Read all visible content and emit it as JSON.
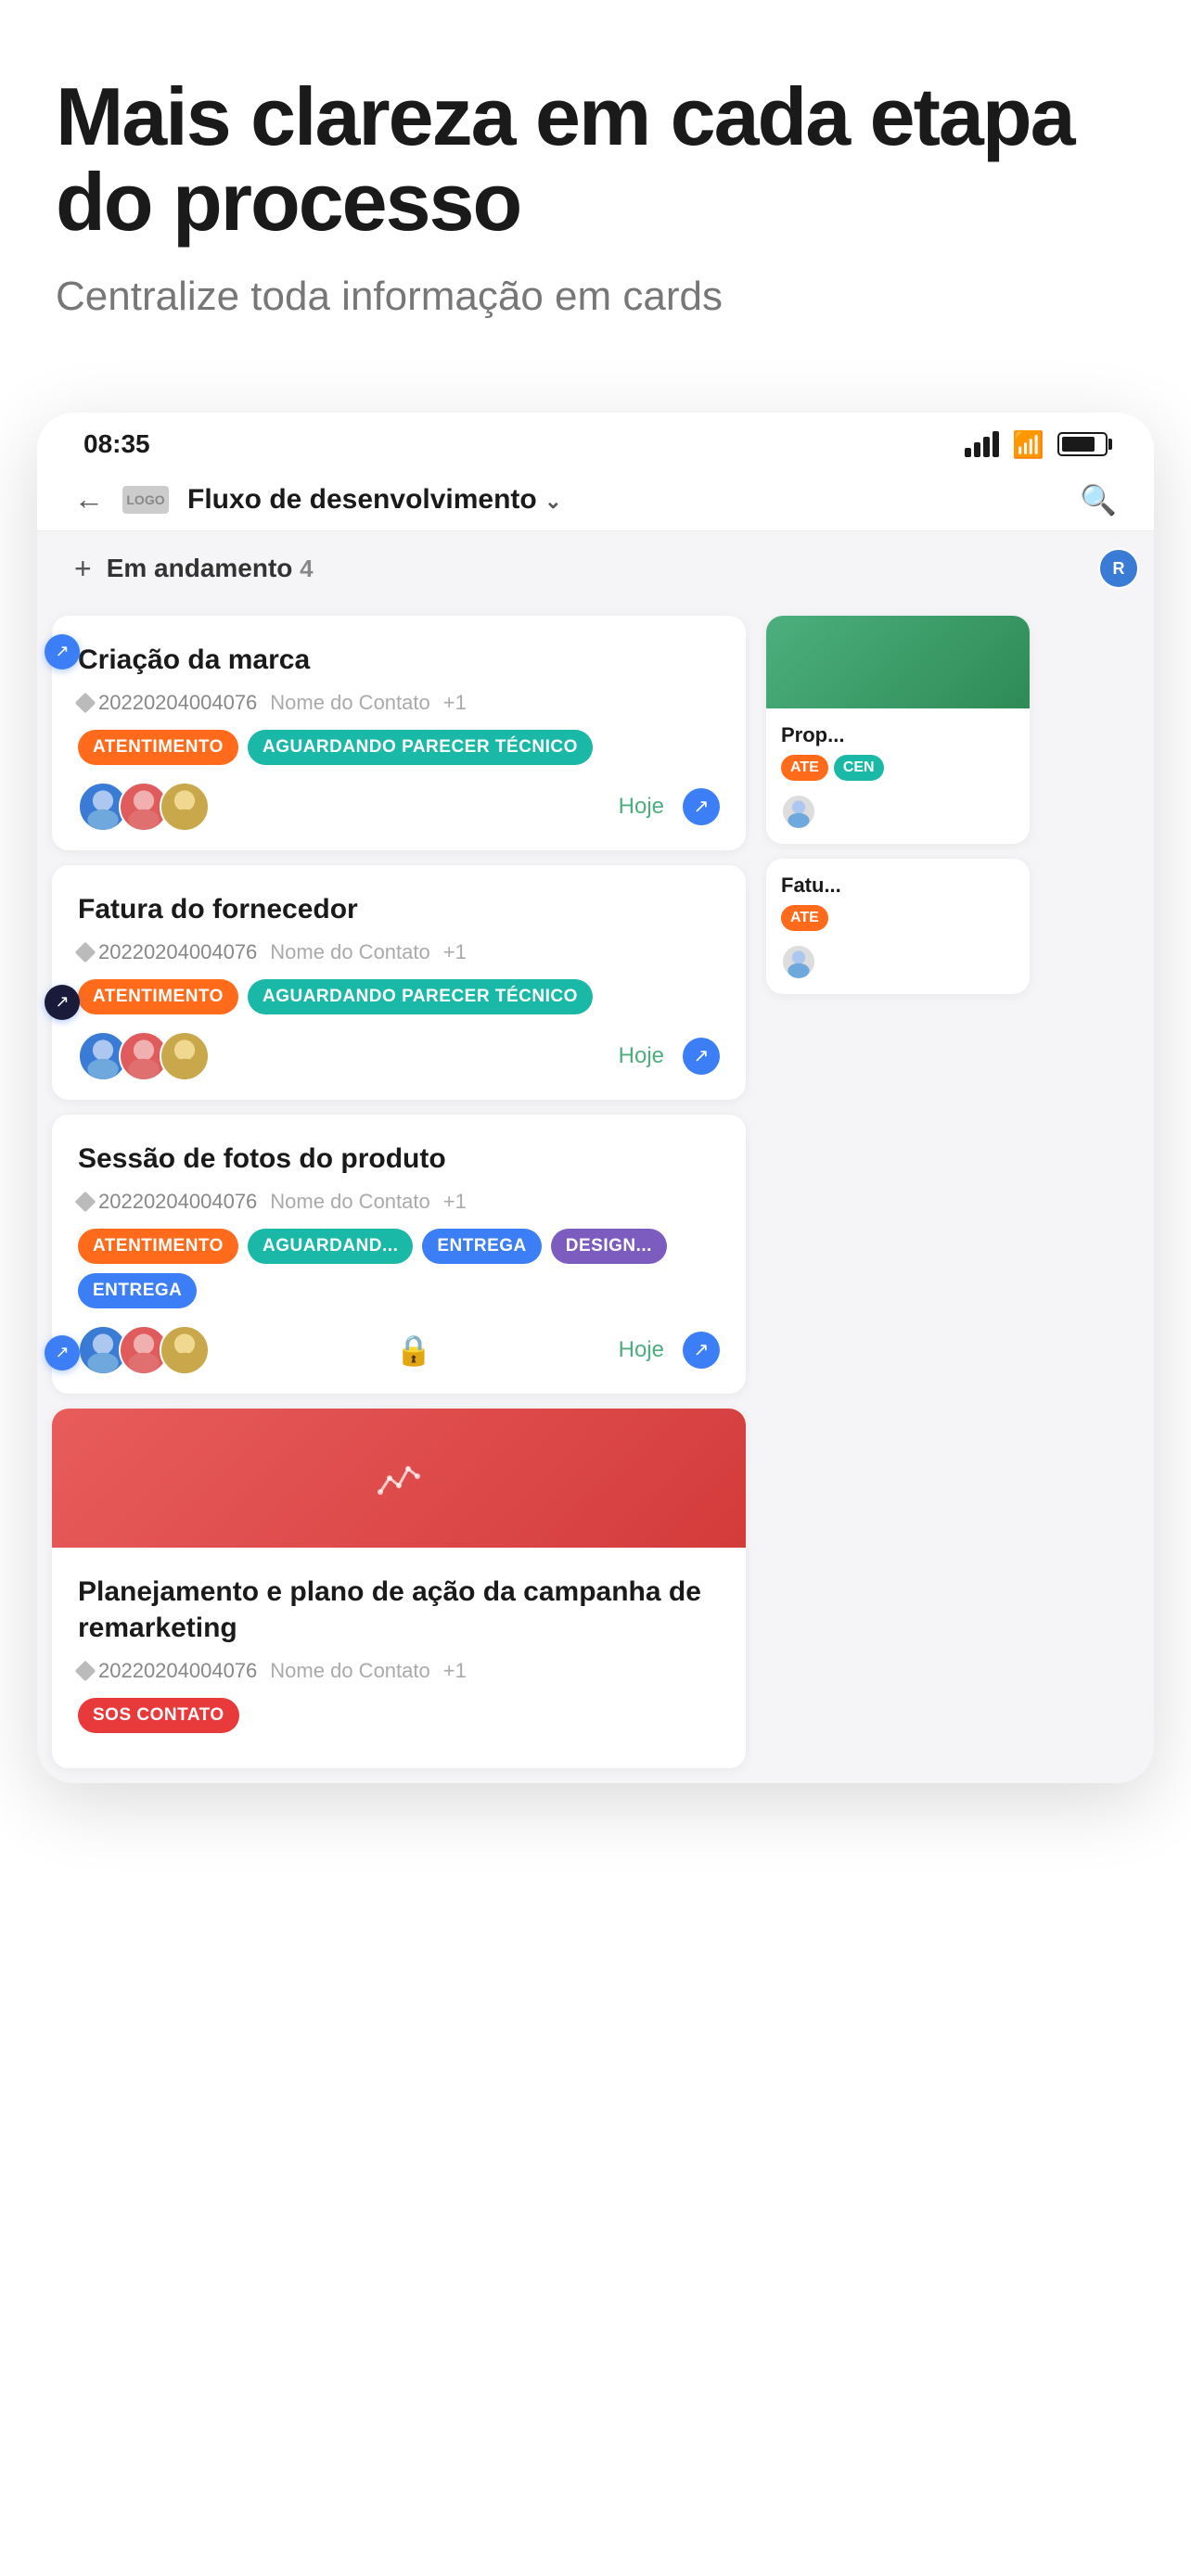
{
  "hero": {
    "title": "Mais clareza em cada etapa do processo",
    "subtitle": "Centralize toda informação em cards"
  },
  "status_bar": {
    "time": "08:35",
    "signal": "signal-icon",
    "wifi": "wifi-icon",
    "battery": "battery-icon"
  },
  "nav": {
    "back_label": "←",
    "logo_label": "LOGO",
    "title": "Fluxo de desenvolvimento",
    "dropdown_icon": "chevron-down",
    "search_icon": "search"
  },
  "column": {
    "add_left_label": "+",
    "title": "Em andamento",
    "count": "4",
    "add_right_label": "+",
    "avatar_label": "R"
  },
  "cards": [
    {
      "id": "card1",
      "title": "Criação da marca",
      "meta_id": "20220204004076",
      "meta_contact": "Nome do Contato",
      "meta_plus": "+1",
      "tags": [
        {
          "label": "ATENTIMENTO",
          "style": "orange"
        },
        {
          "label": "AGUARDANDO PARECER TÉCNICO",
          "style": "teal"
        }
      ],
      "avatars": [
        "blue",
        "red",
        "gold"
      ],
      "date": "Hoje",
      "has_lock": false
    },
    {
      "id": "card2",
      "title": "Fatura do fornecedor",
      "meta_id": "20220204004076",
      "meta_contact": "Nome do Contato",
      "meta_plus": "+1",
      "tags": [
        {
          "label": "ATENTIMENTO",
          "style": "orange"
        },
        {
          "label": "AGUARDANDO PARECER TÉCNICO",
          "style": "teal"
        }
      ],
      "avatars": [
        "blue",
        "red",
        "gold"
      ],
      "date": "Hoje",
      "has_lock": false
    },
    {
      "id": "card3",
      "title": "Sessão de fotos do produto",
      "meta_id": "20220204004076",
      "meta_contact": "Nome do Contato",
      "meta_plus": "+1",
      "tags": [
        {
          "label": "ATENTIMENTO",
          "style": "orange"
        },
        {
          "label": "AGUARDAND...",
          "style": "teal"
        },
        {
          "label": "ENTREGA",
          "style": "blue"
        },
        {
          "label": "DESIGN...",
          "style": "purple"
        },
        {
          "label": "ENTREGA",
          "style": "blue"
        }
      ],
      "avatars": [
        "blue",
        "red",
        "gold"
      ],
      "date": "Hoje",
      "has_lock": true
    },
    {
      "id": "card4",
      "title": "Planejamento e plano de ação da campanha de remarketing",
      "meta_id": "20220204004076",
      "meta_contact": "Nome do Contato",
      "meta_plus": "+1",
      "tags": [
        {
          "label": "SOS CONTATO",
          "style": "red"
        }
      ],
      "avatars": [],
      "date": "",
      "has_banner": true,
      "has_lock": false
    }
  ],
  "side_cards": [
    {
      "id": "side1",
      "img_style": "green",
      "title": "Prop...",
      "tag_label": "ATE",
      "tag_style": "orange",
      "tag2_label": "CEN",
      "tag2_style": "teal",
      "avatars": [
        "blue"
      ]
    },
    {
      "id": "side2",
      "title": "Fatu...",
      "tag_label": "ATE",
      "tag_style": "orange",
      "avatars": [
        "blue"
      ]
    }
  ],
  "open_button_label": "↗",
  "lock_label": "🔒"
}
